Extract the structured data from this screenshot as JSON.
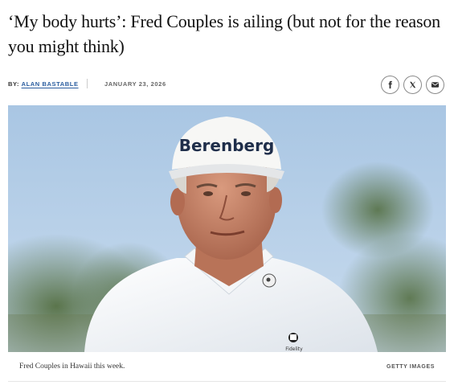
{
  "article": {
    "headline": "‘My body hurts’: Fred Couples is ailing (but not for the reason you might think)",
    "byline_prefix": "BY:",
    "author": "ALAN BASTABLE",
    "date": "JANUARY 23, 2026"
  },
  "share": {
    "icons": [
      "facebook-icon",
      "x-icon",
      "email-icon"
    ]
  },
  "photo": {
    "cap_logo_text": "Berenberg",
    "shirt_logo_text": "Fidelity",
    "caption": "Fred Couples in Hawaii this week.",
    "credit": "GETTY IMAGES"
  },
  "colors": {
    "author_link": "#2a5d9f",
    "headline": "#111111",
    "sky": "#b9d0e6"
  }
}
